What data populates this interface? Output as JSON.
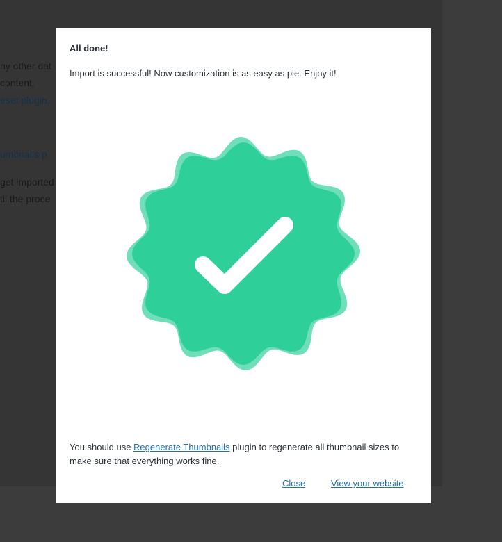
{
  "background": {
    "lines": [
      "ny other dat",
      "content.",
      "eset plugin.",
      "umbnails p",
      "get imported",
      "til the proce"
    ]
  },
  "modal": {
    "title": "All done!",
    "message": "Import is successful! Now customization is as easy as pie. Enjoy it!",
    "badge_icon": "check-badge-icon",
    "badge_color": "#2ecf99",
    "note_prefix": "You should use ",
    "note_link": "Regenerate Thumbnails",
    "note_suffix": " plugin to regenerate all thumbnail sizes to make sure that everything works fine.",
    "close_label": "Close",
    "view_label": "View your website"
  }
}
